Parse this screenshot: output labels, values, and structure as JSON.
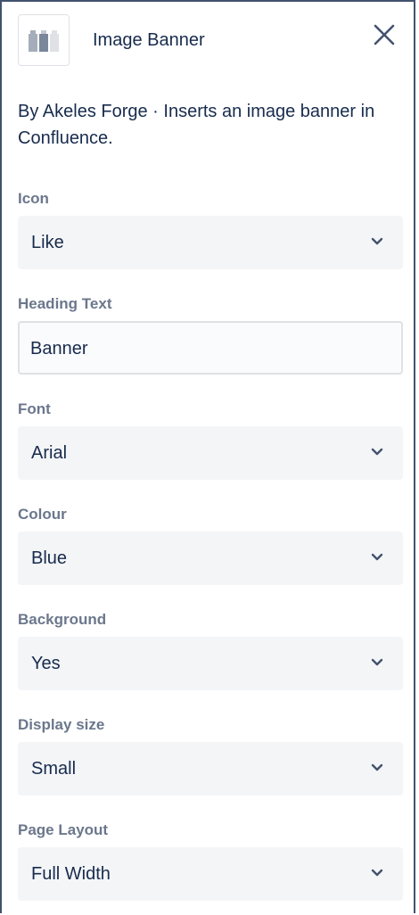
{
  "header": {
    "title": "Image Banner",
    "logo_icon": "app-logo-icon",
    "close_icon": "close-icon"
  },
  "description": "By Akeles Forge · Inserts an image banner in Confluence.",
  "fields": {
    "icon": {
      "label": "Icon",
      "value": "Like"
    },
    "heading_text": {
      "label": "Heading Text",
      "value": "Banner"
    },
    "font": {
      "label": "Font",
      "value": "Arial"
    },
    "colour": {
      "label": "Colour",
      "value": "Blue"
    },
    "background": {
      "label": "Background",
      "value": "Yes"
    },
    "display_size": {
      "label": "Display size",
      "value": "Small"
    },
    "page_layout": {
      "label": "Page Layout",
      "value": "Full Width"
    }
  },
  "colors": {
    "text": "#172b4d",
    "label": "#6b778c",
    "field_bg": "#f4f5f7",
    "border": "#dfe1e6"
  }
}
